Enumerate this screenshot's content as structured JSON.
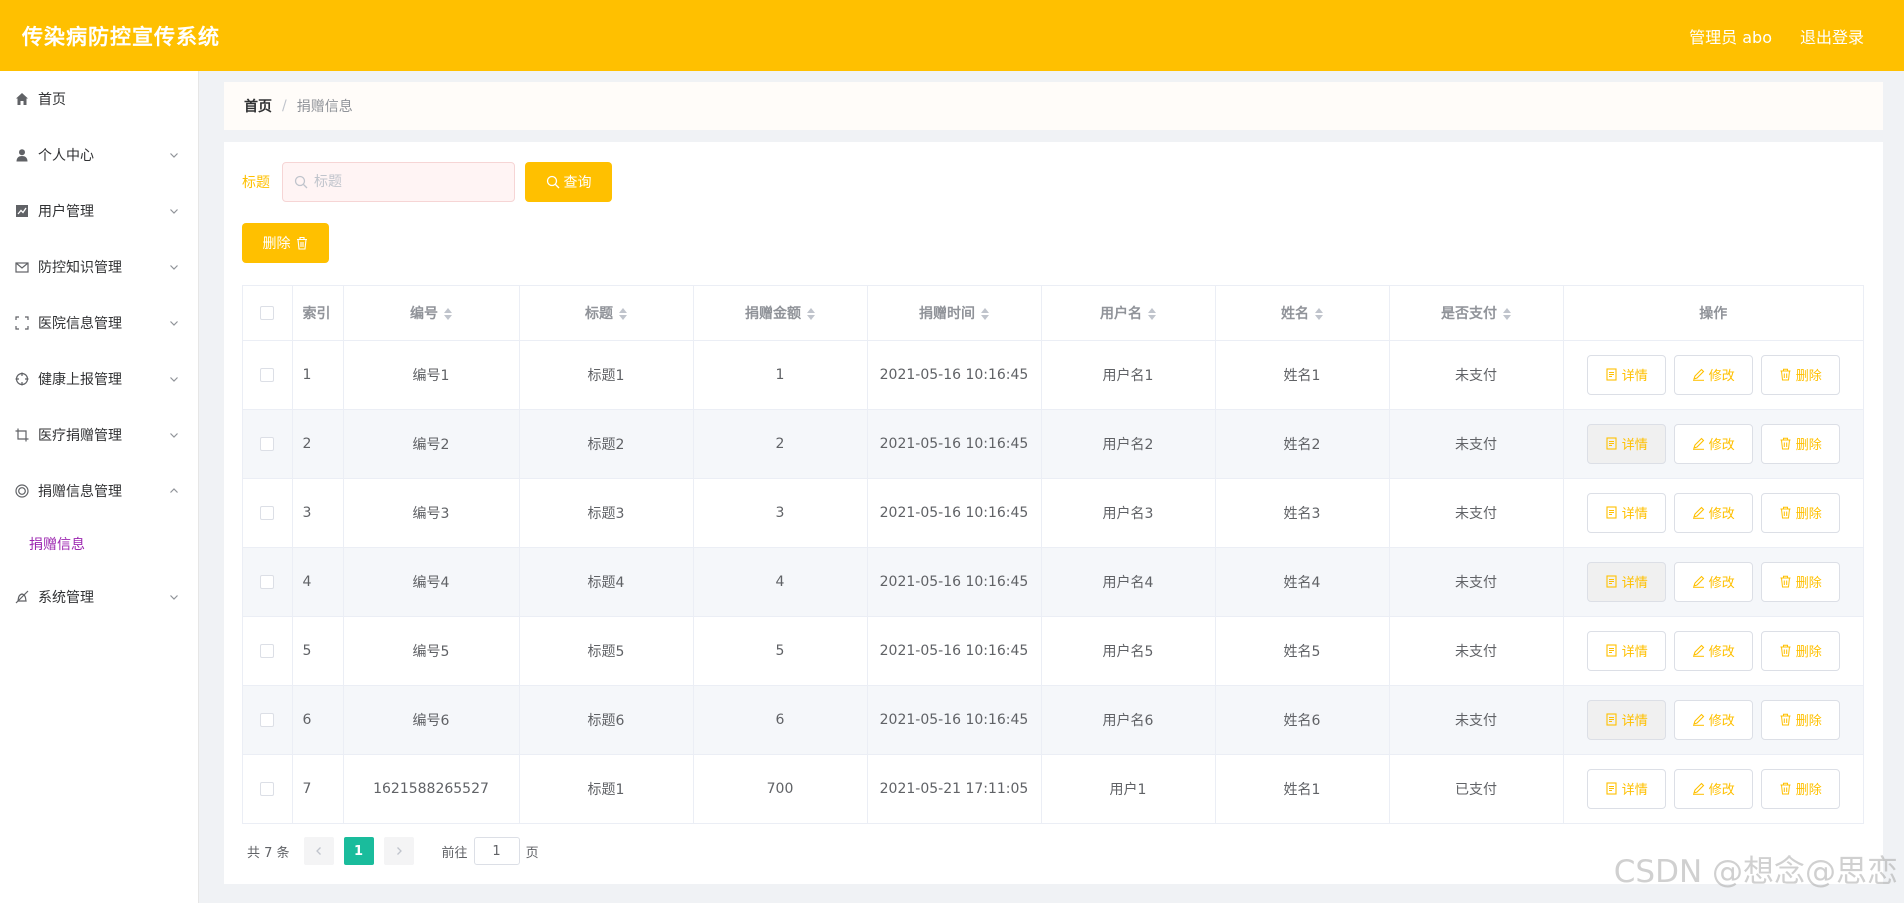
{
  "header": {
    "title": "传染病防控宣传系统",
    "user": "管理员 abo",
    "logout": "退出登录"
  },
  "sidebar": {
    "items": [
      {
        "label": "首页",
        "icon": "home-icon"
      },
      {
        "label": "个人中心",
        "icon": "user-icon"
      },
      {
        "label": "用户管理",
        "icon": "chart-icon"
      },
      {
        "label": "防控知识管理",
        "icon": "message-icon"
      },
      {
        "label": "医院信息管理",
        "icon": "full-screen-icon"
      },
      {
        "label": "健康上报管理",
        "icon": "aim-icon"
      },
      {
        "label": "医疗捐赠管理",
        "icon": "crop-icon"
      },
      {
        "label": "捐赠信息管理",
        "icon": "coin-icon"
      },
      {
        "label": "系统管理",
        "icon": "bell-off-icon"
      }
    ],
    "submenu": {
      "label": "捐赠信息"
    }
  },
  "breadcrumb": {
    "home": "首页",
    "separator": "/",
    "current": "捐赠信息"
  },
  "search": {
    "label": "标题",
    "placeholder": "标题",
    "button": "查询"
  },
  "toolbar": {
    "delete_label": "删除"
  },
  "table": {
    "headers": {
      "index": "索引",
      "code": "编号",
      "title": "标题",
      "amount": "捐赠金额",
      "time": "捐赠时间",
      "username": "用户名",
      "name": "姓名",
      "paid": "是否支付",
      "actions": "操作"
    },
    "action_labels": {
      "detail": "详情",
      "edit": "修改",
      "delete": "删除"
    },
    "rows": [
      {
        "index": "1",
        "code": "编号1",
        "title": "标题1",
        "amount": "1",
        "time": "2021-05-16 10:16:45",
        "username": "用户名1",
        "name": "姓名1",
        "paid": "未支付"
      },
      {
        "index": "2",
        "code": "编号2",
        "title": "标题2",
        "amount": "2",
        "time": "2021-05-16 10:16:45",
        "username": "用户名2",
        "name": "姓名2",
        "paid": "未支付"
      },
      {
        "index": "3",
        "code": "编号3",
        "title": "标题3",
        "amount": "3",
        "time": "2021-05-16 10:16:45",
        "username": "用户名3",
        "name": "姓名3",
        "paid": "未支付"
      },
      {
        "index": "4",
        "code": "编号4",
        "title": "标题4",
        "amount": "4",
        "time": "2021-05-16 10:16:45",
        "username": "用户名4",
        "name": "姓名4",
        "paid": "未支付"
      },
      {
        "index": "5",
        "code": "编号5",
        "title": "标题5",
        "amount": "5",
        "time": "2021-05-16 10:16:45",
        "username": "用户名5",
        "name": "姓名5",
        "paid": "未支付"
      },
      {
        "index": "6",
        "code": "编号6",
        "title": "标题6",
        "amount": "6",
        "time": "2021-05-16 10:16:45",
        "username": "用户名6",
        "name": "姓名6",
        "paid": "未支付"
      },
      {
        "index": "7",
        "code": "1621588265527",
        "title": "标题1",
        "amount": "700",
        "time": "2021-05-21 17:11:05",
        "username": "用户1",
        "name": "姓名1",
        "paid": "已支付"
      }
    ]
  },
  "pagination": {
    "total": "共 7 条",
    "current_page": "1",
    "goto_label": "前往",
    "goto_value": "1",
    "page_suffix": "页"
  },
  "watermark": "CSDN @想念@思恋",
  "colors": {
    "accent": "#ffc000",
    "active_page": "#1abc9c",
    "submenu_active": "#9c27b0"
  }
}
